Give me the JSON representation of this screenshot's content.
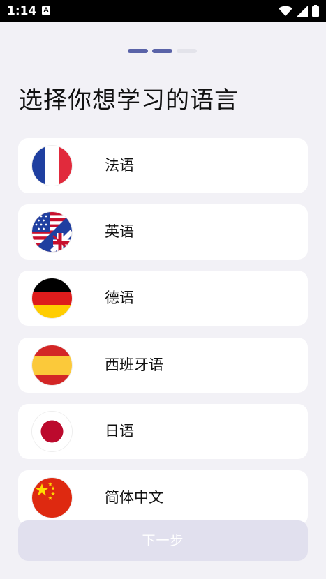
{
  "status_bar": {
    "time": "1:14",
    "notif_glyph": "A",
    "icons": [
      "wifi-icon",
      "signal-icon",
      "battery-icon"
    ]
  },
  "pager": {
    "total": 3,
    "current_step": 2
  },
  "title": "选择你想学习的语言",
  "languages": [
    {
      "label": "法语",
      "flag": "france-flag-icon"
    },
    {
      "label": "英语",
      "flag": "usa-uk-flag-icon"
    },
    {
      "label": "德语",
      "flag": "germany-flag-icon"
    },
    {
      "label": "西班牙语",
      "flag": "spain-flag-icon"
    },
    {
      "label": "日语",
      "flag": "japan-flag-icon"
    },
    {
      "label": "简体中文",
      "flag": "china-flag-icon"
    }
  ],
  "next_button": {
    "label": "下一步",
    "enabled": false
  },
  "colors": {
    "accent": "#5a63a8",
    "background": "#f2f1f6",
    "button_disabled": "#e1e0ee"
  }
}
